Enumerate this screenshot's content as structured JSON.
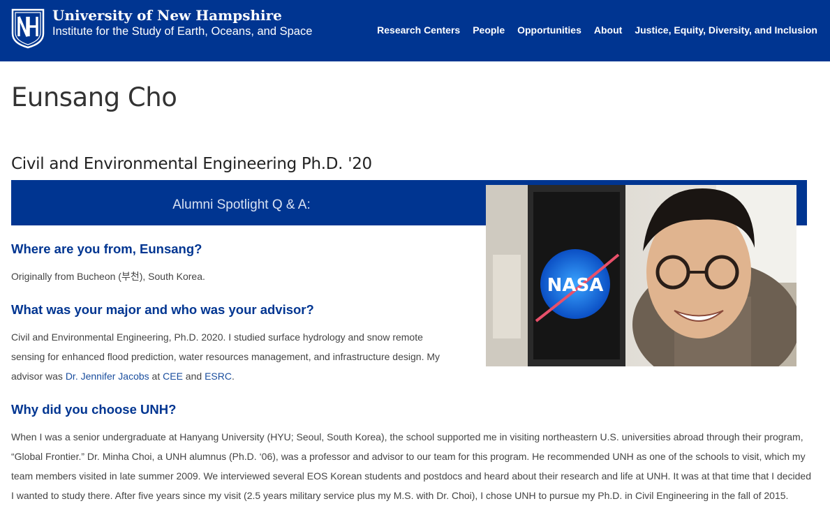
{
  "header": {
    "university": "University of New Hampshire",
    "institute": "Institute for the Study of Earth, Oceans, and Space",
    "nav": [
      "Research Centers",
      "People",
      "Opportunities",
      "About",
      "Justice, Equity, Diversity, and Inclusion"
    ]
  },
  "page": {
    "title": "Eunsang Cho",
    "subtitle": "Civil and Environmental Engineering Ph.D. '20",
    "banner": "Alumni Spotlight Q & A:"
  },
  "photo": {
    "logo_text": "NASA"
  },
  "qa": [
    {
      "question": "Where are you from, Eunsang?",
      "answer": "Originally from Bucheon (부천), South Korea."
    },
    {
      "question": "What was your major and who was your advisor?",
      "answer_prefix": "Civil and Environmental Engineering, Ph.D. 2020. I studied surface hydrology and snow remote sensing for enhanced flood prediction, water resources management, and infrastructure design. My advisor was ",
      "link_advisor": "Dr. Jennifer Jacobs",
      "text_at": " at ",
      "link_cee": "CEE",
      "text_and": " and ",
      "link_esrc": "ESRC",
      "text_end": "."
    },
    {
      "question": "Why did you choose UNH?",
      "answer": "When I was a senior undergraduate at Hanyang University (HYU; Seoul, South Korea), the school supported me in visiting northeastern U.S. universities abroad through their program, “Global Frontier.” Dr. Minha Choi, a UNH alumnus (Ph.D. ‘06), was a professor and advisor to our team for this program. He recommended UNH as one of the schools to visit, which my team members visited in late summer 2009. We interviewed several EOS Korean students and postdocs and heard about their research and life at UNH. It was at that time that I decided I wanted to study there. After five years since my visit (2.5 years military service plus my M.S. with Dr. Choi), I chose UNH to pursue my Ph.D. in Civil Engineering in the fall of 2015."
    }
  ],
  "colors": {
    "brand_blue": "#003591",
    "link": "#1a4e9e"
  }
}
